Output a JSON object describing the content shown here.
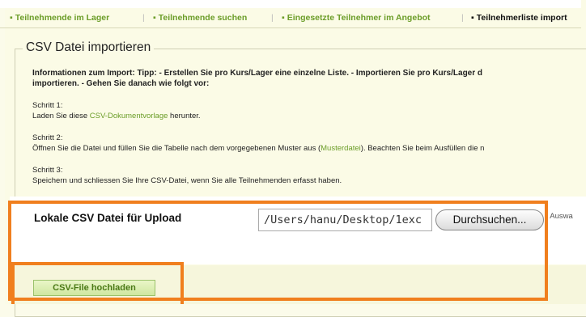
{
  "tabs": [
    {
      "label": "Teilnehmende im Lager"
    },
    {
      "label": "Teilnehmende suchen"
    },
    {
      "label": "Eingesetzte Teilnehmer im Angebot"
    },
    {
      "label": "Teilnehmerliste import"
    }
  ],
  "section": {
    "title": "CSV Datei importieren"
  },
  "info": {
    "line1": "Informationen zum Import: Tipp: - Erstellen Sie pro Kurs/Lager eine einzelne Liste. - Importieren Sie pro Kurs/Lager d",
    "line2": "importieren. - Gehen Sie danach wie folgt vor:"
  },
  "steps": [
    {
      "title": "Schritt 1:",
      "pre": "Laden Sie diese ",
      "link": "CSV-Dokumentvorlage",
      "post": " herunter."
    },
    {
      "title": "Schritt 2:",
      "pre": "Öffnen Sie die Datei und füllen Sie die Tabelle nach dem vorgegebenen Muster aus (",
      "link": "Musterdatei",
      "post": "). Beachten Sie beim Ausfüllen die n"
    },
    {
      "title": "Schritt 3:",
      "text": "Speichern und schliessen Sie Ihre CSV-Datei, wenn Sie alle Teilnehmenden erfasst haben."
    }
  ],
  "upload": {
    "label": "Lokale CSV Datei für Upload",
    "file_value": "/Users/hanu/Desktop/1exc",
    "browse_label": "Durchsuchen...",
    "trailing_text": "r Auswa"
  },
  "submit": {
    "label": "CSV-File hochladen"
  },
  "colors": {
    "highlight": "#f07f1e",
    "link": "#6b9d28",
    "background": "#fbfbe6"
  }
}
